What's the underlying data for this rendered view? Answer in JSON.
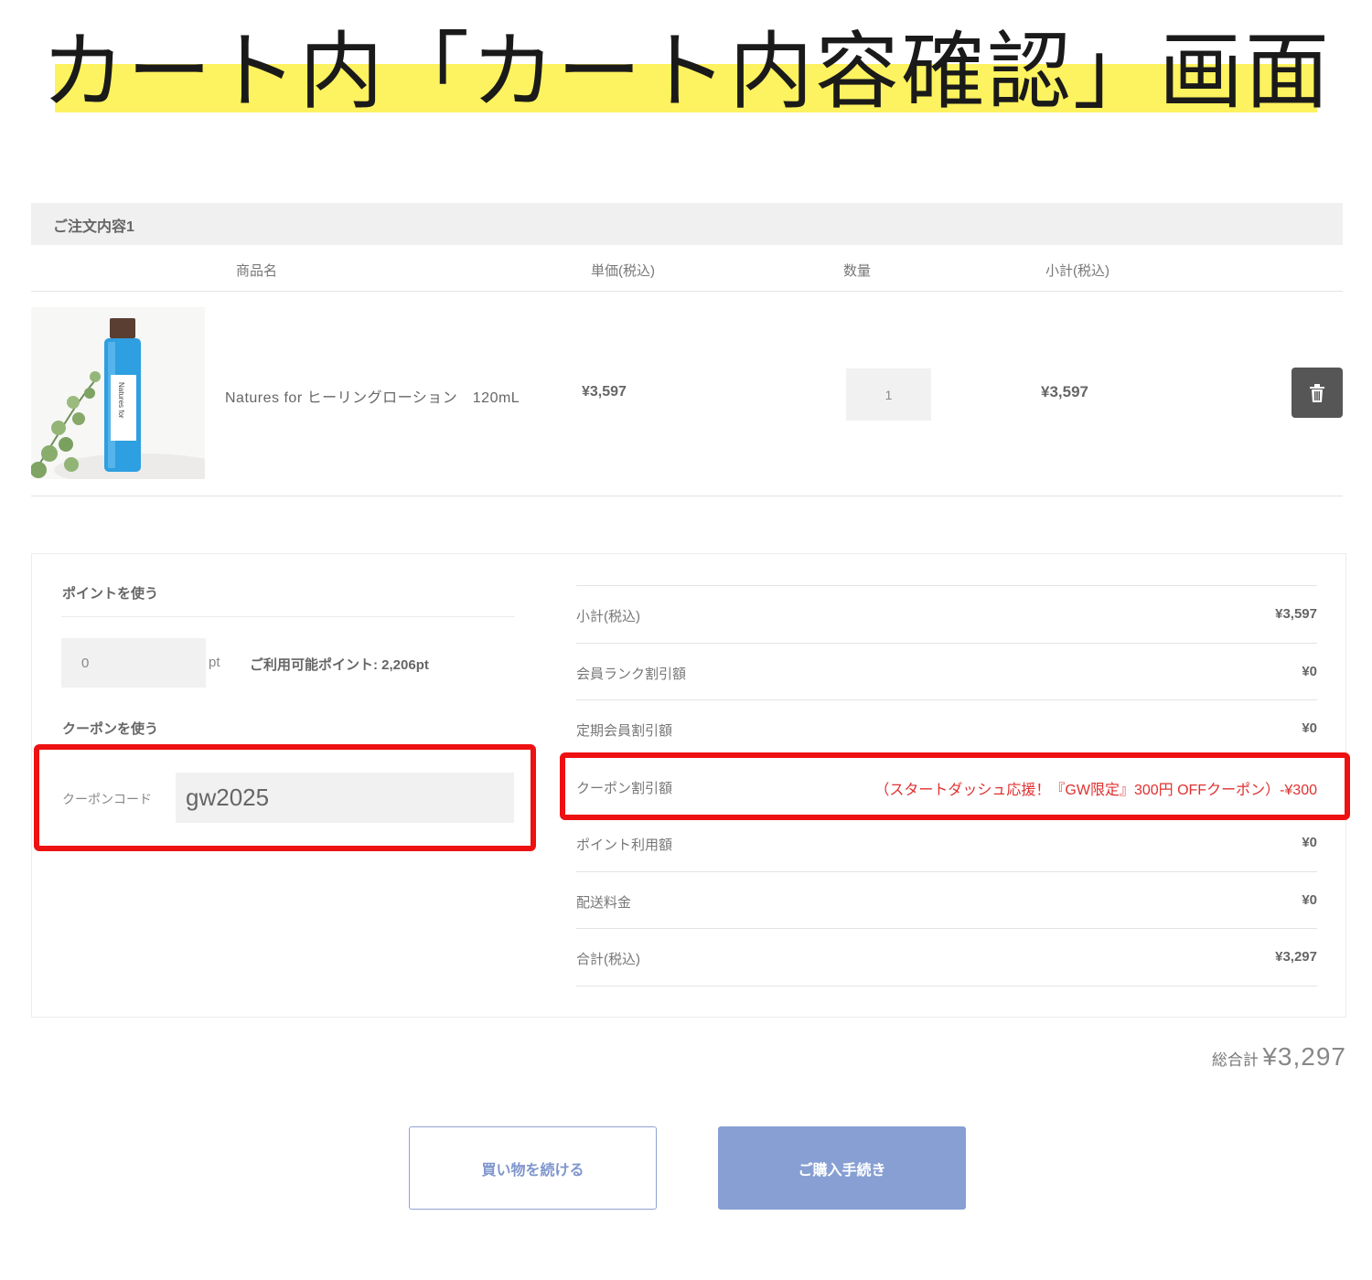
{
  "banner": {
    "title": "カート内「カート内容確認」画面",
    "highlight_color": "#fdf25f"
  },
  "order": {
    "section_label": "ご注文内容1",
    "columns": {
      "product": "商品名",
      "unit_price": "単価(税込)",
      "quantity": "数量",
      "subtotal": "小計(税込)"
    },
    "item": {
      "name": "Natures for ヒーリングローション　120mL",
      "unit_price": "¥3,597",
      "quantity": "1",
      "subtotal": "¥3,597",
      "bottle_label": "Natures for",
      "delete_icon": "trash-icon"
    }
  },
  "points": {
    "section_label": "ポイントを使う",
    "value": "0",
    "unit": "pt",
    "available": "ご利用可能ポイント: 2,206pt"
  },
  "coupon": {
    "section_label": "クーポンを使う",
    "code_label": "クーポンコード",
    "code_value": "gw2025"
  },
  "summary": {
    "rows": [
      {
        "label": "小計(税込)",
        "value": "¥3,597"
      },
      {
        "label": "会員ランク割引額",
        "value": "¥0"
      },
      {
        "label": "定期会員割引額",
        "value": "¥0"
      },
      {
        "label": "クーポン割引額",
        "value": "（スタートダッシュ応援！『GW限定』300円 OFFクーポン）-¥300"
      },
      {
        "label": "ポイント利用額",
        "value": "¥0"
      },
      {
        "label": "配送料金",
        "value": "¥0"
      },
      {
        "label": "合計(税込)",
        "value": "¥3,297"
      }
    ]
  },
  "grand_total": {
    "label": "総合計",
    "value": "¥3,297"
  },
  "buttons": {
    "continue": "買い物を続ける",
    "purchase": "ご購入手続き"
  },
  "colors": {
    "highlight_red": "#ee1111",
    "accent_blue": "#879fd3",
    "discount_red": "#e03030"
  }
}
